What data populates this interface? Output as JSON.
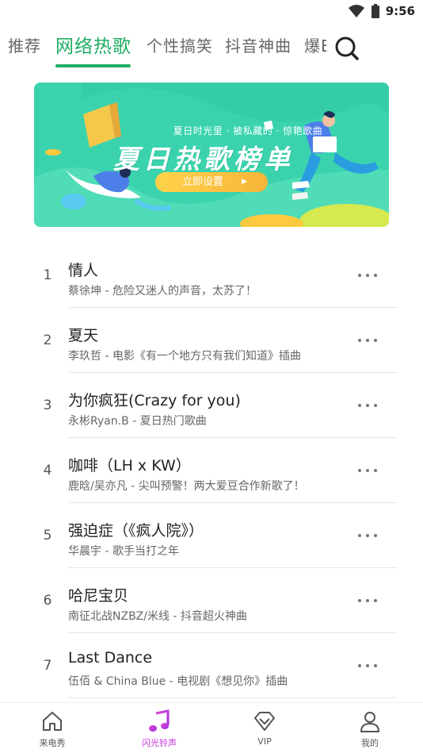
{
  "status_bar": {
    "time": "9:56"
  },
  "tabs": [
    {
      "label": "推荐"
    },
    {
      "label": "网络热歌",
      "active": true
    },
    {
      "label": "个性搞笑"
    },
    {
      "label": "抖音神曲"
    },
    {
      "label": "爆E"
    }
  ],
  "banner": {
    "subtitle": "夏日时光里 · 被私藏的 · 惊艳歌曲",
    "title": "夏日热歌榜单",
    "button_label": "立即设置",
    "button_arrow": "▶"
  },
  "more_glyph": "···",
  "songs": [
    {
      "rank": "1",
      "title": "情人",
      "subtitle": "蔡徐坤 - 危险又迷人的声音，太苏了！"
    },
    {
      "rank": "2",
      "title": "夏天",
      "subtitle": "李玖哲 - 电影《有一个地方只有我们知道》插曲"
    },
    {
      "rank": "3",
      "title": "为你疯狂(Crazy for you)",
      "subtitle": "永彬Ryan.B - 夏日热门歌曲"
    },
    {
      "rank": "4",
      "title": "咖啡（LH x KW）",
      "subtitle": "鹿晗/吴亦凡 - 尖叫预警！两大爱豆合作新歌了！"
    },
    {
      "rank": "5",
      "title": "强迫症（《疯人院》）",
      "subtitle": "华晨宇 - 歌手当打之年"
    },
    {
      "rank": "6",
      "title": "哈尼宝贝",
      "subtitle": "南征北战NZBZ/米线 - 抖音超火神曲"
    },
    {
      "rank": "7",
      "title": "Last Dance",
      "subtitle": "伍佰 & China Blue - 电视剧《想见你》插曲"
    }
  ],
  "bottom_nav": [
    {
      "label": "来电秀",
      "icon": "home-icon"
    },
    {
      "label": "闪光铃声",
      "icon": "music-note-icon",
      "active": true
    },
    {
      "label": "VIP",
      "icon": "diamond-icon"
    },
    {
      "label": "我的",
      "icon": "user-icon"
    }
  ],
  "colors": {
    "accent_green": "#1fae63",
    "active_nav_purple": "#c832d8",
    "banner_bg": "#3fd9b0",
    "banner_button": "#ffc93f"
  }
}
